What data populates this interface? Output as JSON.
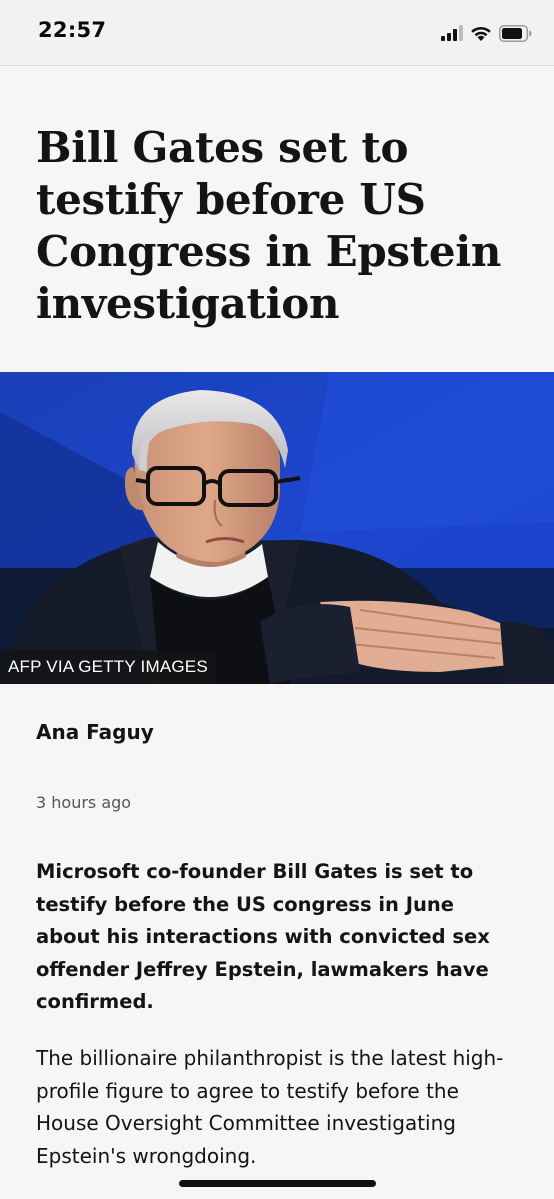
{
  "status_bar": {
    "time": "22:57"
  },
  "article": {
    "headline": "Bill Gates set to testify before US Congress in Epstein investigation",
    "image_caption": "AFP VIA GETTY IMAGES",
    "author": "Ana Faguy",
    "timestamp": "3 hours ago",
    "lead": "Microsoft co-founder Bill Gates is set to testify before the US congress in June about his interactions with convicted sex offender Jeffrey Epstein, lawmakers have confirmed.",
    "body": "The billionaire philanthropist is the latest high-profile figure to agree to testify before the House Oversight Committee investigating Epstein's wrongdoing."
  }
}
